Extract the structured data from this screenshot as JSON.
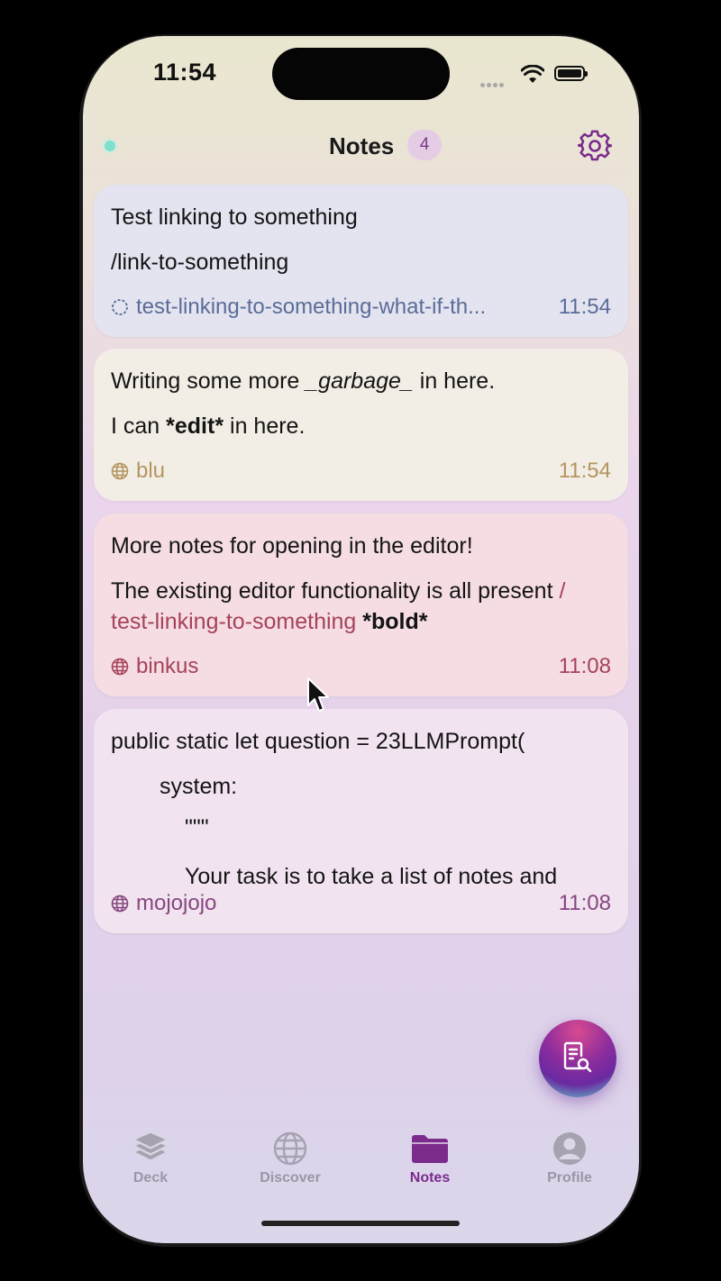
{
  "status_bar": {
    "time": "11:54"
  },
  "header": {
    "title": "Notes",
    "count": "4"
  },
  "notes": [
    {
      "line1": "Test linking to something",
      "line2": "/link-to-something",
      "meta_label": "test-linking-to-something-what-if-th...",
      "time": "11:54",
      "meta_icon": "circle-dashed-icon",
      "accent": "#5a6c98"
    },
    {
      "line1_pre": "Writing some more ",
      "line1_em": "_garbage_",
      "line1_post": " in here.",
      "line2_pre": "I can ",
      "line2_strong": "*edit*",
      "line2_post": " in here.",
      "meta_label": "blu",
      "time": "11:54",
      "meta_icon": "globe-icon",
      "accent": "#b39461"
    },
    {
      "line1": "More notes for opening in the editor!",
      "line2_pre": "The existing editor functionality is all present ",
      "line2_link_a": "/",
      "line3_link": "test-linking-to-something",
      "line3_strong": " *bold*",
      "meta_label": "binkus",
      "time": "11:08",
      "meta_icon": "globe-icon",
      "accent": "#a6425a"
    },
    {
      "line1": "public static let question = 23LLMPrompt(",
      "line2": "system:",
      "line3": "\"\"\"",
      "line4": "Your task is to take a list of notes and",
      "meta_label": "mojojojo",
      "time": "11:08",
      "meta_icon": "globe-icon",
      "accent": "#86467e"
    }
  ],
  "tabs": [
    {
      "label": "Deck",
      "icon": "stack-icon",
      "active": false
    },
    {
      "label": "Discover",
      "icon": "globe-icon",
      "active": false
    },
    {
      "label": "Notes",
      "icon": "folder-icon",
      "active": true
    },
    {
      "label": "Profile",
      "icon": "person-icon",
      "active": false
    }
  ],
  "colors": {
    "active_tab": "#7a2b8c",
    "inactive_tab": "#9a96a6"
  }
}
